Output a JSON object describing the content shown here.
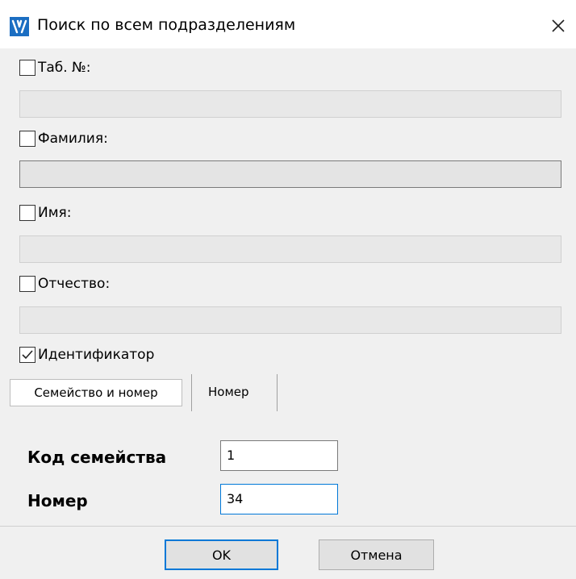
{
  "window": {
    "title": "Поиск по всем подразделениям"
  },
  "fields": {
    "tab_no": {
      "label": "Таб. №:",
      "checked": false,
      "value": ""
    },
    "surname": {
      "label": "Фамилия:",
      "checked": false,
      "value": ""
    },
    "name": {
      "label": "Имя:",
      "checked": false,
      "value": ""
    },
    "patronymic": {
      "label": "Отчество:",
      "checked": false,
      "value": ""
    },
    "identifier": {
      "label": "Идентификатор",
      "checked": true
    }
  },
  "tabs": [
    {
      "label": "Семейство и номер",
      "active": true
    },
    {
      "label": "Номер",
      "active": false
    }
  ],
  "identifier_form": {
    "family_code_label": "Код семейства",
    "family_code_value": "1",
    "number_label": "Номер",
    "number_value": "34"
  },
  "buttons": {
    "ok": "OK",
    "cancel": "Отмена"
  },
  "colors": {
    "accent": "#0078d7",
    "dialog_bg": "#f0f0f0",
    "icon_blue": "#1b6ec2"
  }
}
